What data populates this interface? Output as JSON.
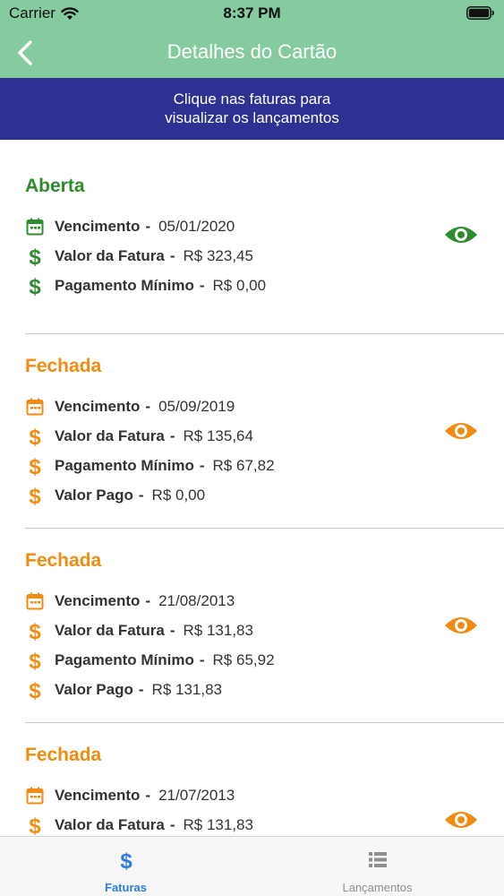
{
  "status_bar": {
    "carrier": "Carrier",
    "time": "8:37 PM"
  },
  "nav": {
    "title": "Detalhes do Cartão"
  },
  "hint": {
    "line1": "Clique nas faturas para",
    "line2": "visualizar os lançamentos"
  },
  "colors": {
    "open": "#2e8b2e",
    "closed": "#f08c10",
    "nav_bg": "#86cba0",
    "banner_bg": "#2e3092",
    "tab_active": "#2a7ee0",
    "tab_inactive": "#8e8e8e"
  },
  "faturas": [
    {
      "status": "Aberta",
      "rows": [
        {
          "icon": "calendar-icon",
          "label": "Vencimento",
          "value": "05/01/2020"
        },
        {
          "icon": "dollar-icon",
          "label": "Valor da Fatura",
          "value": "R$ 323,45"
        },
        {
          "icon": "dollar-icon",
          "label": "Pagamento Mínimo",
          "value": "R$ 0,00"
        }
      ]
    },
    {
      "status": "Fechada",
      "rows": [
        {
          "icon": "calendar-icon",
          "label": "Vencimento",
          "value": "05/09/2019"
        },
        {
          "icon": "dollar-icon",
          "label": "Valor da Fatura",
          "value": "R$ 135,64"
        },
        {
          "icon": "dollar-icon",
          "label": "Pagamento Mínimo",
          "value": "R$ 67,82"
        },
        {
          "icon": "dollar-icon",
          "label": "Valor Pago",
          "value": "R$ 0,00"
        }
      ]
    },
    {
      "status": "Fechada",
      "rows": [
        {
          "icon": "calendar-icon",
          "label": "Vencimento",
          "value": "21/08/2013"
        },
        {
          "icon": "dollar-icon",
          "label": "Valor da Fatura",
          "value": "R$ 131,83"
        },
        {
          "icon": "dollar-icon",
          "label": "Pagamento Mínimo",
          "value": "R$ 65,92"
        },
        {
          "icon": "dollar-icon",
          "label": "Valor Pago",
          "value": "R$ 131,83"
        }
      ]
    },
    {
      "status": "Fechada",
      "rows": [
        {
          "icon": "calendar-icon",
          "label": "Vencimento",
          "value": "21/07/2013"
        },
        {
          "icon": "dollar-icon",
          "label": "Valor da Fatura",
          "value": "R$ 131,83"
        }
      ]
    }
  ],
  "row_separator": "-",
  "tabs": [
    {
      "label": "Faturas",
      "icon": "dollar-icon",
      "active": true
    },
    {
      "label": "Lançamentos",
      "icon": "list-icon",
      "active": false
    }
  ]
}
